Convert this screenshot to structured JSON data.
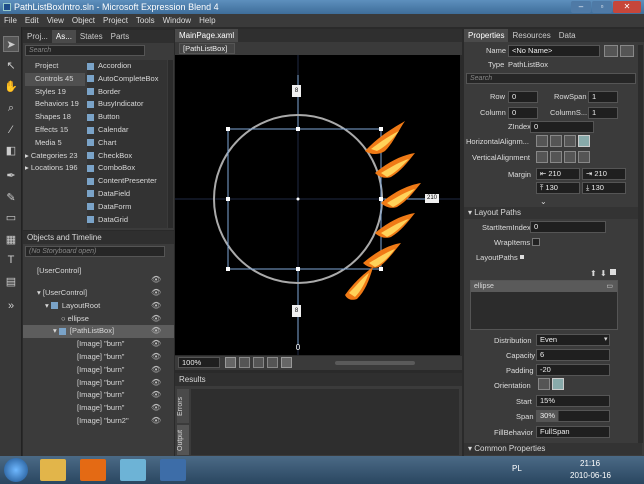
{
  "window": {
    "title": "PathListBoxIntro.sln - Microsoft Expression Blend 4"
  },
  "menu": [
    "File",
    "Edit",
    "View",
    "Object",
    "Project",
    "Tools",
    "Window",
    "Help"
  ],
  "left_top": {
    "tabs": [
      "Proj...",
      "As...",
      "States",
      "Parts"
    ],
    "search_placeholder": "Search",
    "categories": [
      {
        "label": "Project",
        "count": ""
      },
      {
        "label": "Controls",
        "count": "45"
      },
      {
        "label": "Styles",
        "count": "19"
      },
      {
        "label": "Behaviors",
        "count": "19"
      },
      {
        "label": "Shapes",
        "count": "18"
      },
      {
        "label": "Effects",
        "count": "15"
      },
      {
        "label": "Media",
        "count": "5"
      },
      {
        "label": "Categories",
        "count": "23"
      },
      {
        "label": "Locations",
        "count": "196"
      }
    ],
    "assets": [
      "Accordion",
      "AutoCompleteBox",
      "Border",
      "BusyIndicator",
      "Button",
      "Calendar",
      "Chart",
      "CheckBox",
      "ComboBox",
      "ContentPresenter",
      "DataField",
      "DataForm",
      "DataGrid"
    ]
  },
  "objects": {
    "title": "Objects and Timeline",
    "storyboard": "(No Storyboard open)",
    "scope": "[UserControl]",
    "items": [
      {
        "label": "[UserControl]",
        "indent": 1
      },
      {
        "label": "LayoutRoot",
        "indent": 2
      },
      {
        "label": "ellipse",
        "indent": 3
      },
      {
        "label": "[PathListBox]",
        "indent": 3
      },
      {
        "label": "[Image] \"burn\"",
        "indent": 4
      },
      {
        "label": "[Image] \"burn\"",
        "indent": 4
      },
      {
        "label": "[Image] \"burn\"",
        "indent": 4
      },
      {
        "label": "[Image] \"burn\"",
        "indent": 4
      },
      {
        "label": "[Image] \"burn\"",
        "indent": 4
      },
      {
        "label": "[Image] \"burn\"",
        "indent": 4
      },
      {
        "label": "[Image] \"burn2\"",
        "indent": 4
      }
    ]
  },
  "doc": {
    "tab": "MainPage.xaml",
    "breadcrumb": "[PathListBox]",
    "zoom": "100%",
    "dims": {
      "top": "8",
      "right": "210",
      "bottom": "8",
      "center": "0"
    },
    "results_title": "Results",
    "results_tabs": [
      "Errors",
      "Output"
    ]
  },
  "props": {
    "tabs": [
      "Properties",
      "Resources",
      "Data"
    ],
    "name_label": "Name",
    "name_value": "<No Name>",
    "type_label": "Type",
    "type_value": "PathListBox",
    "search_placeholder": "Search",
    "row_label": "Row",
    "row_value": "0",
    "rowspan_label": "RowSpan",
    "rowspan_value": "1",
    "col_label": "Column",
    "col_value": "0",
    "colspan_label": "ColumnS...",
    "colspan_value": "1",
    "zindex_label": "ZIndex",
    "zindex_value": "0",
    "halign_label": "HorizontalAlignm...",
    "valign_label": "VerticalAlignment",
    "margin_label": "Margin",
    "margins": [
      "210",
      "210",
      "130",
      "130"
    ],
    "layout_paths_header": "Layout Paths",
    "startitem_label": "StartItemIndex",
    "startitem_value": "0",
    "wrap_label": "WrapItems",
    "layoutpaths_label": "LayoutPaths",
    "path_item": "ellipse",
    "distribution_label": "Distribution",
    "distribution_value": "Even",
    "capacity_label": "Capacity",
    "capacity_value": "6",
    "padding_label": "Padding",
    "padding_value": "-20",
    "orientation_label": "Orientation",
    "start_label": "Start",
    "start_value": "15%",
    "span_label": "Span",
    "span_value": "30%",
    "fill_label": "FillBehavior",
    "fill_value": "FullSpan",
    "common_header": "Common Properties"
  },
  "taskbar": {
    "lang": "PL",
    "time": "21:16",
    "date": "2010-06-16"
  }
}
